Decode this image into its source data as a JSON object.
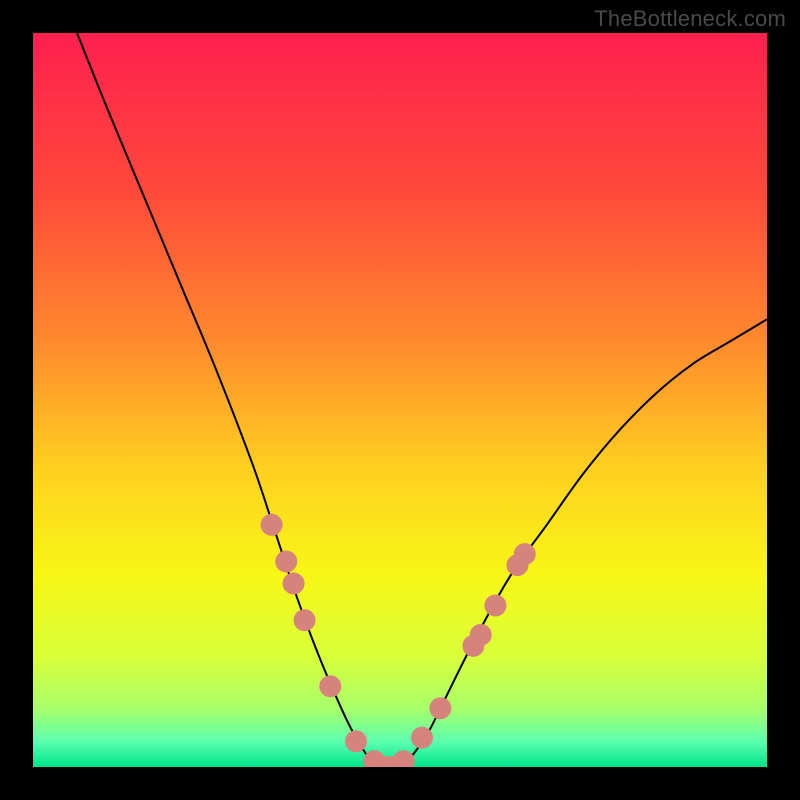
{
  "watermark": "TheBottleneck.com",
  "chart_data": {
    "type": "line",
    "title": "",
    "xlabel": "",
    "ylabel": "",
    "xlim": [
      0,
      100
    ],
    "ylim": [
      0,
      100
    ],
    "grid": false,
    "legend": false,
    "curve": {
      "name": "bottleneck-curve",
      "color": "#000000",
      "x": [
        6,
        10,
        15,
        20,
        25,
        30,
        33,
        36,
        39,
        42,
        44,
        46,
        48,
        50,
        52,
        54,
        56,
        60,
        65,
        70,
        75,
        80,
        85,
        90,
        95,
        100
      ],
      "y": [
        100,
        90,
        78,
        66,
        54,
        41,
        32,
        23,
        15,
        8,
        4,
        1,
        0,
        0,
        2,
        5,
        9,
        17,
        26,
        33,
        40,
        46,
        51,
        55,
        58,
        61
      ]
    },
    "markers": {
      "name": "highlighted-points",
      "color": "#d7837d",
      "radius": 11,
      "x": [
        32.5,
        34.5,
        35.5,
        37.0,
        40.5,
        44.0,
        46.5,
        48.0,
        49.0,
        49.5,
        50.5,
        53.0,
        55.5,
        60.0,
        61.0,
        63.0,
        66.0,
        67.0
      ],
      "y": [
        33.0,
        28.0,
        25.0,
        20.0,
        11.0,
        3.5,
        0.8,
        0.0,
        0.0,
        0.0,
        0.8,
        4.0,
        8.0,
        16.5,
        18.0,
        22.0,
        27.5,
        29.0
      ]
    },
    "background_gradient": {
      "stops": [
        {
          "pos": 0.0,
          "color": "#ff1f4f"
        },
        {
          "pos": 0.22,
          "color": "#ff4a3a"
        },
        {
          "pos": 0.42,
          "color": "#ff8a2e"
        },
        {
          "pos": 0.6,
          "color": "#ffd21f"
        },
        {
          "pos": 0.74,
          "color": "#f7f716"
        },
        {
          "pos": 0.85,
          "color": "#d8ff3a"
        },
        {
          "pos": 0.92,
          "color": "#a8ff6a"
        },
        {
          "pos": 0.965,
          "color": "#5dffb0"
        },
        {
          "pos": 1.0,
          "color": "#00e48a"
        }
      ]
    }
  }
}
